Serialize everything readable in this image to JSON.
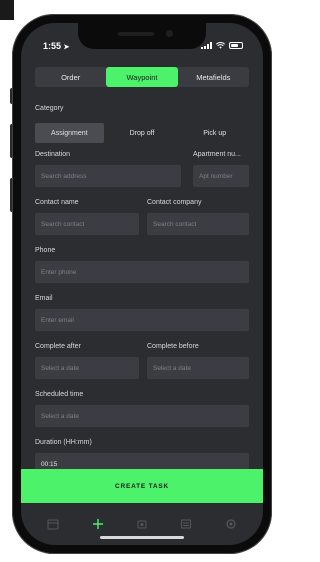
{
  "status_bar": {
    "time": "1:55",
    "icons": [
      "location-icon",
      "signal-icon",
      "wifi-icon",
      "battery-icon"
    ]
  },
  "tabs": [
    {
      "label": "Order",
      "active": false
    },
    {
      "label": "Waypoint",
      "active": true
    },
    {
      "label": "Metafields",
      "active": false
    }
  ],
  "category": {
    "label": "Category",
    "options": [
      {
        "label": "Assignment",
        "selected": true
      },
      {
        "label": "Drop off",
        "selected": false
      },
      {
        "label": "Pick up",
        "selected": false
      }
    ]
  },
  "destination": {
    "label": "Destination",
    "placeholder": "Search address"
  },
  "apartment": {
    "label": "Apartment nu...",
    "placeholder": "Apt number"
  },
  "contact_name": {
    "label": "Contact name",
    "placeholder": "Search contact"
  },
  "contact_company": {
    "label": "Contact company",
    "placeholder": "Search contact"
  },
  "phone": {
    "label": "Phone",
    "placeholder": "Enter phone"
  },
  "email": {
    "label": "Email",
    "placeholder": "Enter email"
  },
  "complete_after": {
    "label": "Complete after",
    "placeholder": "Select a date"
  },
  "complete_before": {
    "label": "Complete before",
    "placeholder": "Select a date"
  },
  "scheduled_time": {
    "label": "Scheduled time",
    "placeholder": "Select a date"
  },
  "duration": {
    "label": "Duration (HH:mm)",
    "value": "00:15"
  },
  "cta": {
    "label": "CREATE TASK"
  },
  "bottom_nav": [
    "calendar-icon",
    "plus-icon",
    "drivers-icon",
    "list-icon",
    "settings-icon"
  ],
  "colors": {
    "accent": "#4cf26a",
    "screen_bg": "#2b2d31",
    "field_bg": "#3b3d42"
  }
}
